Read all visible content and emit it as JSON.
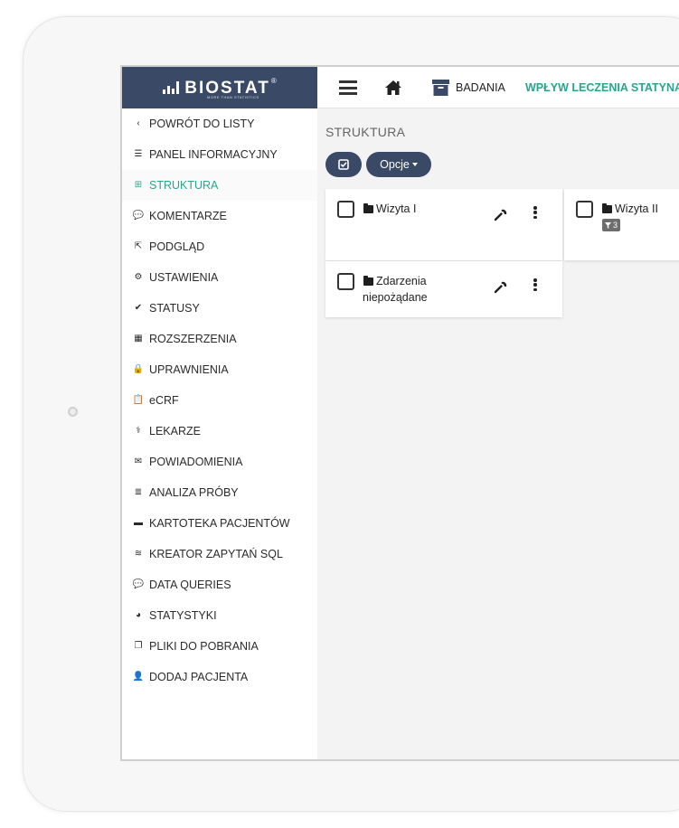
{
  "header": {
    "logo_text": "BIOSTAT",
    "logo_reg": "®",
    "logo_tagline": "MORE THAN STATISTICS",
    "badania_label": "BADANIA",
    "study_title": "WPŁYW LECZENIA STATYNĄ N"
  },
  "sidebar": {
    "items": [
      {
        "label": "POWRÓT DO LISTY",
        "icon": "chevron-left-icon"
      },
      {
        "label": "PANEL INFORMACYJNY",
        "icon": "list-icon"
      },
      {
        "label": "STRUKTURA",
        "icon": "plus-square-icon",
        "active": true
      },
      {
        "label": "KOMENTARZE",
        "icon": "comments-icon"
      },
      {
        "label": "PODGLĄD",
        "icon": "external-link-icon"
      },
      {
        "label": "USTAWIENIA",
        "icon": "gears-icon"
      },
      {
        "label": "STATUSY",
        "icon": "check-icon"
      },
      {
        "label": "ROZSZERZENIA",
        "icon": "grid-icon"
      },
      {
        "label": "UPRAWNIENIA",
        "icon": "lock-icon"
      },
      {
        "label": "eCRF",
        "icon": "clipboard-icon"
      },
      {
        "label": "LEKARZE",
        "icon": "doctor-icon"
      },
      {
        "label": "POWIADOMIENIA",
        "icon": "envelope-icon"
      },
      {
        "label": "ANALIZA PRÓBY",
        "icon": "tasks-icon"
      },
      {
        "label": "KARTOTEKA PACJENTÓW",
        "icon": "folder-icon"
      },
      {
        "label": "KREATOR ZAPYTAŃ SQL",
        "icon": "database-icon"
      },
      {
        "label": "DATA QUERIES",
        "icon": "comments-icon"
      },
      {
        "label": "STATYSTYKI",
        "icon": "pie-chart-icon"
      },
      {
        "label": "PLIKI DO POBRANIA",
        "icon": "files-icon"
      },
      {
        "label": "DODAJ PACJENTA",
        "icon": "user-icon"
      }
    ]
  },
  "main": {
    "title": "STRUKTURA",
    "opcje_label": "Opcje",
    "cards": [
      {
        "line1": "Wizyta I",
        "line2": ""
      },
      {
        "line1": "Zdarzenia",
        "line2": "niepożądane"
      },
      {
        "line1": "Wizyta II",
        "line2": "",
        "filter_count": "3"
      }
    ]
  },
  "colors": {
    "brand": "#3a4a66",
    "accent": "#2aa58d"
  }
}
